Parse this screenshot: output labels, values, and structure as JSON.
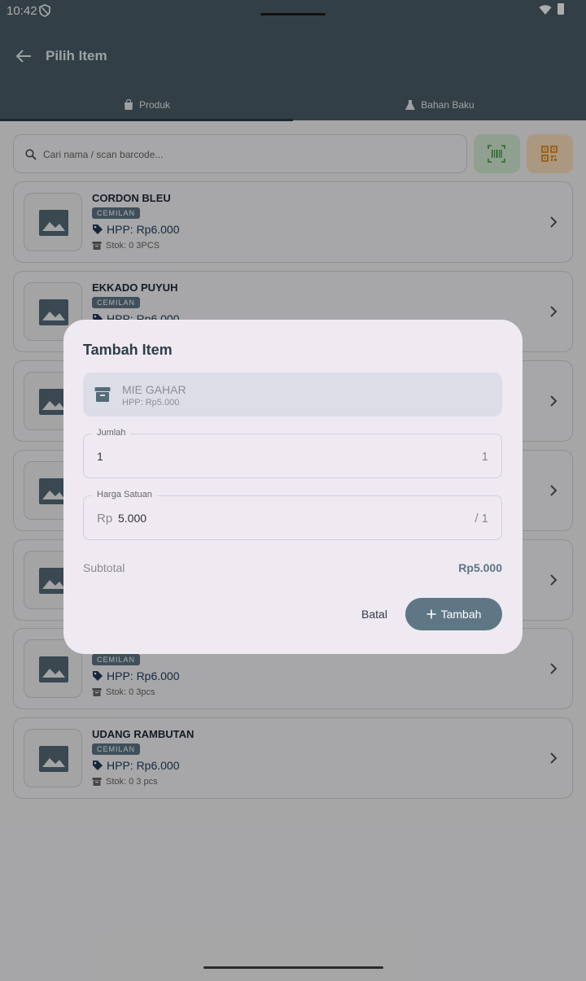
{
  "status": {
    "time": "10:42"
  },
  "appbar": {
    "title": "Pilih Item"
  },
  "tabs": [
    {
      "label": "Produk",
      "icon": "shopping-bag-icon"
    },
    {
      "label": "Bahan Baku",
      "icon": "flask-icon"
    }
  ],
  "search": {
    "placeholder": "Cari nama / scan barcode..."
  },
  "products": [
    {
      "name": "CORDON BLEU",
      "category": "CEMILAN",
      "hpp": "HPP: Rp6.000",
      "stok": "Stok: 0 3PCS"
    },
    {
      "name": "EKKADO PUYUH",
      "category": "CEMILAN",
      "hpp": "HPP: Rp6.000",
      "stok": ""
    },
    {
      "name": "",
      "category": "",
      "hpp": "",
      "stok": ""
    },
    {
      "name": "",
      "category": "",
      "hpp": "",
      "stok": ""
    },
    {
      "name": "",
      "category": "",
      "hpp": "",
      "stok": ""
    },
    {
      "name": "",
      "category": "CEMILAN",
      "hpp": "HPP: Rp6.000",
      "stok": "Stok: 0 3pcs"
    },
    {
      "name": "UDANG RAMBUTAN",
      "category": "CEMILAN",
      "hpp": "HPP: Rp6.000",
      "stok": "Stok: 0 3 pcs"
    }
  ],
  "dialog": {
    "title": "Tambah Item",
    "item_name": "MIE GAHAR",
    "item_hpp": "HPP: Rp5.000",
    "jumlah_label": "Jumlah",
    "jumlah_value": "1",
    "jumlah_suffix": "1",
    "harga_label": "Harga Satuan",
    "harga_prefix": "Rp",
    "harga_value": "5.000",
    "harga_suffix": "/ 1",
    "subtotal_label": "Subtotal",
    "subtotal_value": "Rp5.000",
    "cancel_label": "Batal",
    "add_label": "Tambah"
  },
  "colors": {
    "appbar": "#4a5d68",
    "accent": "#5f7785",
    "barcode_bg": "#d4ecd4",
    "qr_bg": "#fbe1bd"
  }
}
